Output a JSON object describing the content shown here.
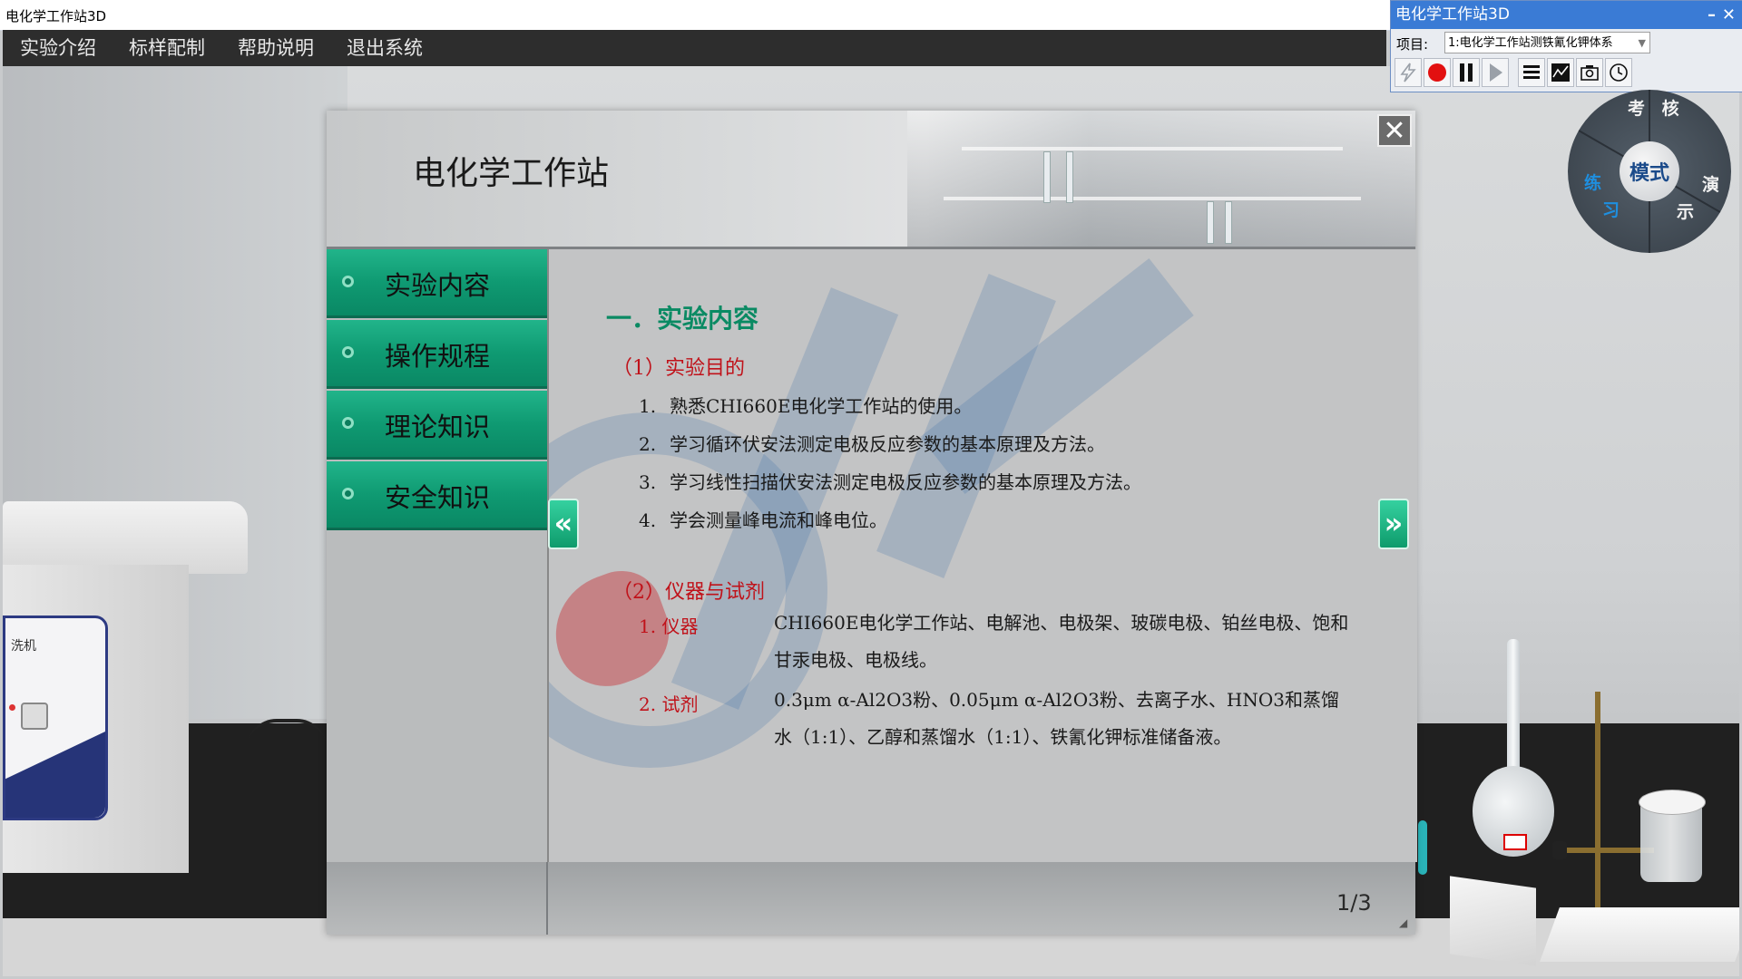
{
  "window": {
    "title": "电化学工作站3D"
  },
  "menu": {
    "items": [
      "实验介绍",
      "标样配制",
      "帮助说明",
      "退出系统"
    ]
  },
  "scene": {
    "machine_label": "洗机"
  },
  "tool_window": {
    "title": "电化学工作站3D",
    "minimize": "–",
    "close": "✕",
    "project_label": "项目:",
    "project_value": "1:电化学工作站测铁氰化钾体系"
  },
  "mode_wheel": {
    "center": "模式",
    "exam": "考 核",
    "practice_1": "练",
    "practice_2": "习",
    "demo_1": "演",
    "demo_2": "示"
  },
  "dialog": {
    "title": "电化学工作站",
    "close_label": "✕",
    "tabs": [
      "实验内容",
      "操作规程",
      "理论知识",
      "安全知识"
    ],
    "prev_label": "«",
    "next_label": "»",
    "page": "1/3",
    "content": {
      "heading": "一．实验内容",
      "section1_title": "（1）实验目的",
      "objectives": [
        {
          "num": "1.",
          "text": "熟悉CHI660E电化学工作站的使用。"
        },
        {
          "num": "2.",
          "text": "学习循环伏安法测定电极反应参数的基本原理及方法。"
        },
        {
          "num": "3.",
          "text": "学习线性扫描伏安法测定电极反应参数的基本原理及方法。"
        },
        {
          "num": "4.",
          "text": "学会测量峰电流和峰电位。"
        }
      ],
      "section2_title": "（2）仪器与试剂",
      "instruments_label": "1. 仪器",
      "instruments_text": "CHI660E电化学工作站、电解池、电极架、玻碳电极、铂丝电极、饱和甘汞电极、电极线。",
      "reagents_label": "2. 试剂",
      "reagents_text": "0.3μm α-Al2O3粉、0.05μm α-Al2O3粉、去离子水、HNO3和蒸馏水（1:1）、乙醇和蒸馏水（1:1）、铁氰化钾标准储备液。"
    }
  },
  "colors": {
    "accent_green": "#0a8a63",
    "tab_green": "#12a57a",
    "heading_red": "#c0121a",
    "tool_title_blue": "#3a7bd5",
    "record_red": "#e21010"
  }
}
